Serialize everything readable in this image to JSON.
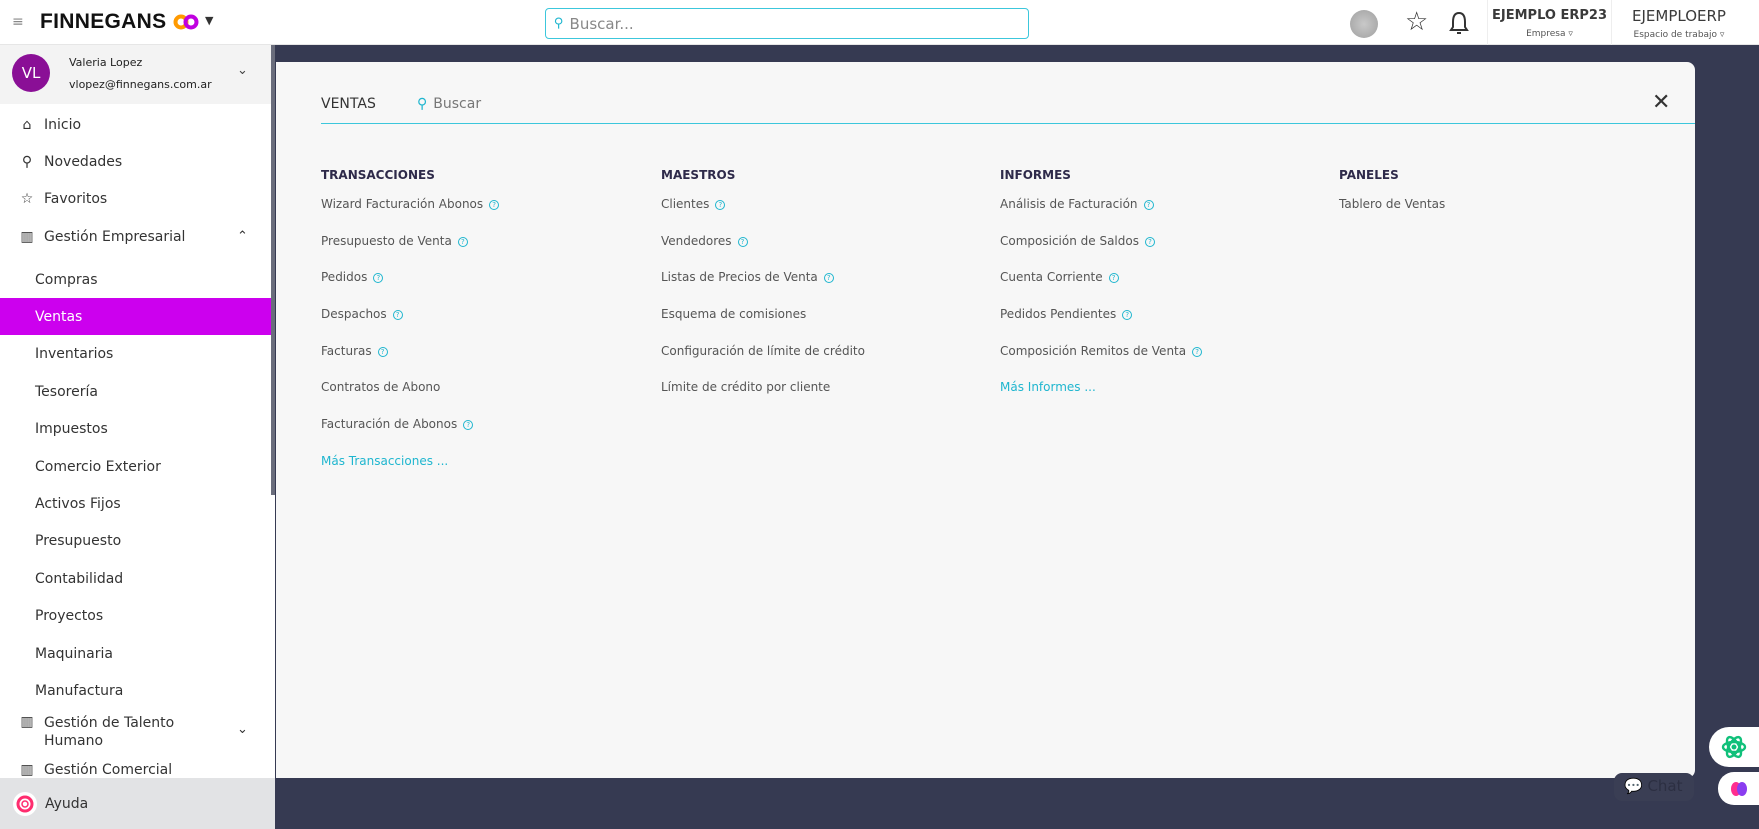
{
  "header": {
    "brand": "FINNEGANS",
    "search_placeholder": "Buscar...",
    "company": {
      "name": "EJEMPLO ERP23",
      "label": "Empresa ▿"
    },
    "workspace": {
      "name": "EJEMPLOERP",
      "label": "Espacio de trabajo ▿"
    }
  },
  "user": {
    "initials": "VL",
    "name": "Valeria Lopez",
    "email": "vlopez@finnegans.com.ar"
  },
  "sidebar": {
    "items": [
      {
        "label": "Inicio",
        "icon": "home-icon"
      },
      {
        "label": "Novedades",
        "icon": "pin-icon"
      },
      {
        "label": "Favoritos",
        "icon": "star-icon"
      },
      {
        "label": "Gestión Empresarial",
        "icon": "building-icon"
      }
    ],
    "subitems": [
      "Compras",
      "Ventas",
      "Inventarios",
      "Tesorería",
      "Impuestos",
      "Comercio Exterior",
      "Activos Fijos",
      "Presupuesto",
      "Contabilidad",
      "Proyectos",
      "Maquinaria",
      "Manufactura"
    ],
    "active": "Ventas",
    "group2_line1": "Gestión de Talento",
    "group2_line2": "Humano",
    "group3": "Gestión Comercial",
    "help": "Ayuda"
  },
  "panel": {
    "title": "VENTAS",
    "search_placeholder": "Buscar",
    "columns": [
      {
        "title": "TRANSACCIONES",
        "items": [
          {
            "label": "Wizard Facturación Abonos",
            "help": true
          },
          {
            "label": "Presupuesto de Venta",
            "help": true
          },
          {
            "label": "Pedidos",
            "help": true
          },
          {
            "label": "Despachos",
            "help": true
          },
          {
            "label": "Facturas",
            "help": true
          },
          {
            "label": "Contratos de Abono",
            "help": false
          },
          {
            "label": "Facturación de Abonos",
            "help": true
          }
        ],
        "more": "Más Transacciones ..."
      },
      {
        "title": "MAESTROS",
        "items": [
          {
            "label": "Clientes",
            "help": true
          },
          {
            "label": "Vendedores",
            "help": true
          },
          {
            "label": "Listas de Precios de Venta",
            "help": true
          },
          {
            "label": "Esquema de comisiones",
            "help": false
          },
          {
            "label": "Configuración de límite de crédito",
            "help": false
          },
          {
            "label": "Límite de crédito por cliente",
            "help": false
          }
        ]
      },
      {
        "title": "INFORMES",
        "items": [
          {
            "label": "Análisis de Facturación",
            "help": true
          },
          {
            "label": "Composición de Saldos",
            "help": true
          },
          {
            "label": "Cuenta Corriente",
            "help": true
          },
          {
            "label": "Pedidos Pendientes",
            "help": true
          },
          {
            "label": "Composición Remitos de Venta",
            "help": true
          }
        ],
        "more": "Más Informes ..."
      },
      {
        "title": "PANELES",
        "items": [
          {
            "label": "Tablero de Ventas",
            "help": false
          }
        ]
      }
    ]
  },
  "chat_label": "Chat",
  "colors": {
    "accent": "#cc00ee",
    "teal": "#1fb6cf",
    "background": "#363a52"
  }
}
